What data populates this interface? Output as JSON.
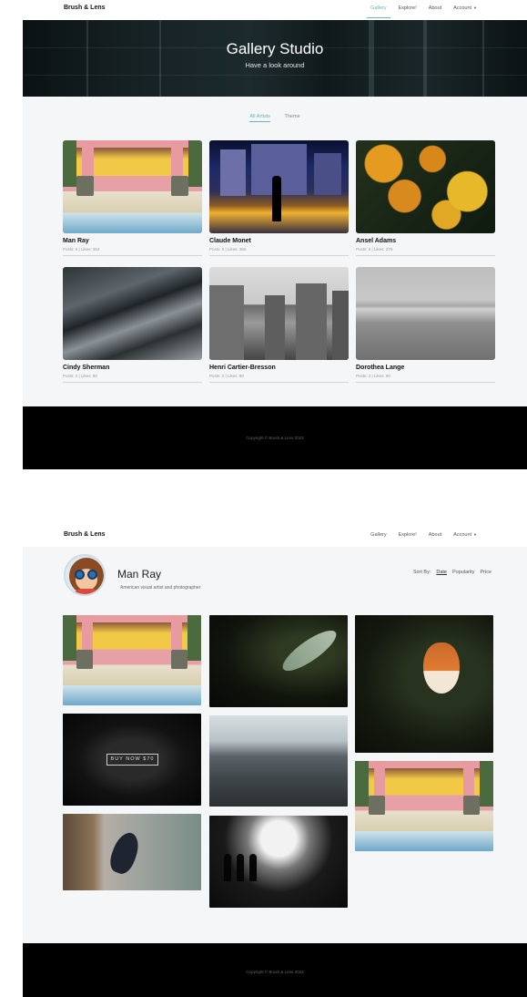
{
  "brand": "Brush & Lens",
  "nav": {
    "gallery": "Gallery",
    "explore": "Explore!",
    "about": "About",
    "account": "Account"
  },
  "hero": {
    "title": "Gallery Studio",
    "subtitle": "Have a look around"
  },
  "tabs": {
    "all_artists": "All Artists",
    "theme": "Theme"
  },
  "artists": [
    {
      "name": "Man Ray",
      "meta": "Posts: 6 | Likes: 352"
    },
    {
      "name": "Claude Monet",
      "meta": "Posts: 8 | Likes: 365"
    },
    {
      "name": "Ansel Adams",
      "meta": "Posts: 6 | Likes: 275"
    },
    {
      "name": "Cindy Sherman",
      "meta": "Posts: 2 | Likes: 90"
    },
    {
      "name": "Henri Cartier-Bresson",
      "meta": "Posts: 2 | Likes: 90"
    },
    {
      "name": "Dorothea Lange",
      "meta": "Posts: 2 | Likes: 90"
    }
  ],
  "footer": {
    "copyright": "Copyright © Brush & Lens 2023"
  },
  "profile": {
    "name": "Man Ray",
    "description": "American visual artist and photographer",
    "sort_label": "Sort By:",
    "sort_options": [
      "Date",
      "Popularity",
      "Price"
    ],
    "buy_label": "BUY NOW $70"
  },
  "colors": {
    "accent": "#6fb1b8",
    "footer": "#000000",
    "section_bg": "#f4f6f7"
  }
}
